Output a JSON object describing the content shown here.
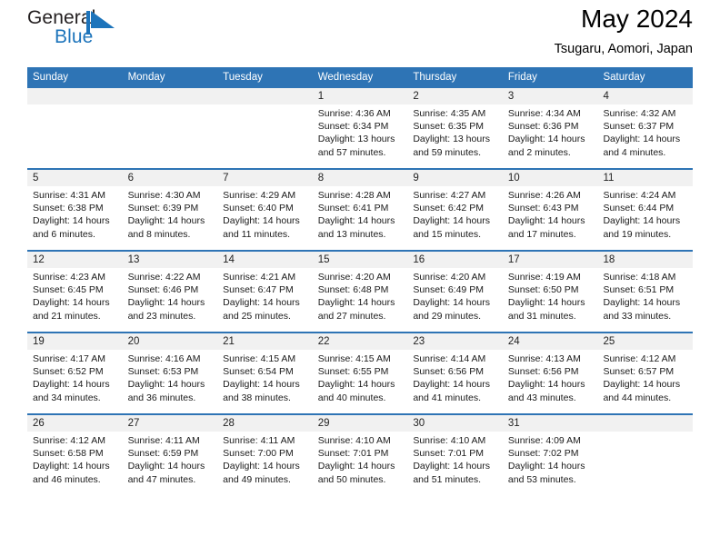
{
  "logo": {
    "word_one": "General",
    "word_two": "Blue",
    "mark_name": "blue-triangle-flag-icon",
    "color_dark": "#231f20",
    "color_blue": "#1d74bb"
  },
  "header": {
    "title": "May 2024",
    "subtitle": "Tsugaru, Aomori, Japan"
  },
  "theme": {
    "header_blue": "#2e74b5",
    "day_strip_gray": "#f1f1f1",
    "text": "#1a1a1a"
  },
  "weekdays": [
    "Sunday",
    "Monday",
    "Tuesday",
    "Wednesday",
    "Thursday",
    "Friday",
    "Saturday"
  ],
  "weeks": [
    [
      {
        "day": "",
        "sunrise": "",
        "sunset": "",
        "daylight_line1": "",
        "daylight_line2": ""
      },
      {
        "day": "",
        "sunrise": "",
        "sunset": "",
        "daylight_line1": "",
        "daylight_line2": ""
      },
      {
        "day": "",
        "sunrise": "",
        "sunset": "",
        "daylight_line1": "",
        "daylight_line2": ""
      },
      {
        "day": "1",
        "sunrise": "Sunrise: 4:36 AM",
        "sunset": "Sunset: 6:34 PM",
        "daylight_line1": "Daylight: 13 hours",
        "daylight_line2": "and 57 minutes."
      },
      {
        "day": "2",
        "sunrise": "Sunrise: 4:35 AM",
        "sunset": "Sunset: 6:35 PM",
        "daylight_line1": "Daylight: 13 hours",
        "daylight_line2": "and 59 minutes."
      },
      {
        "day": "3",
        "sunrise": "Sunrise: 4:34 AM",
        "sunset": "Sunset: 6:36 PM",
        "daylight_line1": "Daylight: 14 hours",
        "daylight_line2": "and 2 minutes."
      },
      {
        "day": "4",
        "sunrise": "Sunrise: 4:32 AM",
        "sunset": "Sunset: 6:37 PM",
        "daylight_line1": "Daylight: 14 hours",
        "daylight_line2": "and 4 minutes."
      }
    ],
    [
      {
        "day": "5",
        "sunrise": "Sunrise: 4:31 AM",
        "sunset": "Sunset: 6:38 PM",
        "daylight_line1": "Daylight: 14 hours",
        "daylight_line2": "and 6 minutes."
      },
      {
        "day": "6",
        "sunrise": "Sunrise: 4:30 AM",
        "sunset": "Sunset: 6:39 PM",
        "daylight_line1": "Daylight: 14 hours",
        "daylight_line2": "and 8 minutes."
      },
      {
        "day": "7",
        "sunrise": "Sunrise: 4:29 AM",
        "sunset": "Sunset: 6:40 PM",
        "daylight_line1": "Daylight: 14 hours",
        "daylight_line2": "and 11 minutes."
      },
      {
        "day": "8",
        "sunrise": "Sunrise: 4:28 AM",
        "sunset": "Sunset: 6:41 PM",
        "daylight_line1": "Daylight: 14 hours",
        "daylight_line2": "and 13 minutes."
      },
      {
        "day": "9",
        "sunrise": "Sunrise: 4:27 AM",
        "sunset": "Sunset: 6:42 PM",
        "daylight_line1": "Daylight: 14 hours",
        "daylight_line2": "and 15 minutes."
      },
      {
        "day": "10",
        "sunrise": "Sunrise: 4:26 AM",
        "sunset": "Sunset: 6:43 PM",
        "daylight_line1": "Daylight: 14 hours",
        "daylight_line2": "and 17 minutes."
      },
      {
        "day": "11",
        "sunrise": "Sunrise: 4:24 AM",
        "sunset": "Sunset: 6:44 PM",
        "daylight_line1": "Daylight: 14 hours",
        "daylight_line2": "and 19 minutes."
      }
    ],
    [
      {
        "day": "12",
        "sunrise": "Sunrise: 4:23 AM",
        "sunset": "Sunset: 6:45 PM",
        "daylight_line1": "Daylight: 14 hours",
        "daylight_line2": "and 21 minutes."
      },
      {
        "day": "13",
        "sunrise": "Sunrise: 4:22 AM",
        "sunset": "Sunset: 6:46 PM",
        "daylight_line1": "Daylight: 14 hours",
        "daylight_line2": "and 23 minutes."
      },
      {
        "day": "14",
        "sunrise": "Sunrise: 4:21 AM",
        "sunset": "Sunset: 6:47 PM",
        "daylight_line1": "Daylight: 14 hours",
        "daylight_line2": "and 25 minutes."
      },
      {
        "day": "15",
        "sunrise": "Sunrise: 4:20 AM",
        "sunset": "Sunset: 6:48 PM",
        "daylight_line1": "Daylight: 14 hours",
        "daylight_line2": "and 27 minutes."
      },
      {
        "day": "16",
        "sunrise": "Sunrise: 4:20 AM",
        "sunset": "Sunset: 6:49 PM",
        "daylight_line1": "Daylight: 14 hours",
        "daylight_line2": "and 29 minutes."
      },
      {
        "day": "17",
        "sunrise": "Sunrise: 4:19 AM",
        "sunset": "Sunset: 6:50 PM",
        "daylight_line1": "Daylight: 14 hours",
        "daylight_line2": "and 31 minutes."
      },
      {
        "day": "18",
        "sunrise": "Sunrise: 4:18 AM",
        "sunset": "Sunset: 6:51 PM",
        "daylight_line1": "Daylight: 14 hours",
        "daylight_line2": "and 33 minutes."
      }
    ],
    [
      {
        "day": "19",
        "sunrise": "Sunrise: 4:17 AM",
        "sunset": "Sunset: 6:52 PM",
        "daylight_line1": "Daylight: 14 hours",
        "daylight_line2": "and 34 minutes."
      },
      {
        "day": "20",
        "sunrise": "Sunrise: 4:16 AM",
        "sunset": "Sunset: 6:53 PM",
        "daylight_line1": "Daylight: 14 hours",
        "daylight_line2": "and 36 minutes."
      },
      {
        "day": "21",
        "sunrise": "Sunrise: 4:15 AM",
        "sunset": "Sunset: 6:54 PM",
        "daylight_line1": "Daylight: 14 hours",
        "daylight_line2": "and 38 minutes."
      },
      {
        "day": "22",
        "sunrise": "Sunrise: 4:15 AM",
        "sunset": "Sunset: 6:55 PM",
        "daylight_line1": "Daylight: 14 hours",
        "daylight_line2": "and 40 minutes."
      },
      {
        "day": "23",
        "sunrise": "Sunrise: 4:14 AM",
        "sunset": "Sunset: 6:56 PM",
        "daylight_line1": "Daylight: 14 hours",
        "daylight_line2": "and 41 minutes."
      },
      {
        "day": "24",
        "sunrise": "Sunrise: 4:13 AM",
        "sunset": "Sunset: 6:56 PM",
        "daylight_line1": "Daylight: 14 hours",
        "daylight_line2": "and 43 minutes."
      },
      {
        "day": "25",
        "sunrise": "Sunrise: 4:12 AM",
        "sunset": "Sunset: 6:57 PM",
        "daylight_line1": "Daylight: 14 hours",
        "daylight_line2": "and 44 minutes."
      }
    ],
    [
      {
        "day": "26",
        "sunrise": "Sunrise: 4:12 AM",
        "sunset": "Sunset: 6:58 PM",
        "daylight_line1": "Daylight: 14 hours",
        "daylight_line2": "and 46 minutes."
      },
      {
        "day": "27",
        "sunrise": "Sunrise: 4:11 AM",
        "sunset": "Sunset: 6:59 PM",
        "daylight_line1": "Daylight: 14 hours",
        "daylight_line2": "and 47 minutes."
      },
      {
        "day": "28",
        "sunrise": "Sunrise: 4:11 AM",
        "sunset": "Sunset: 7:00 PM",
        "daylight_line1": "Daylight: 14 hours",
        "daylight_line2": "and 49 minutes."
      },
      {
        "day": "29",
        "sunrise": "Sunrise: 4:10 AM",
        "sunset": "Sunset: 7:01 PM",
        "daylight_line1": "Daylight: 14 hours",
        "daylight_line2": "and 50 minutes."
      },
      {
        "day": "30",
        "sunrise": "Sunrise: 4:10 AM",
        "sunset": "Sunset: 7:01 PM",
        "daylight_line1": "Daylight: 14 hours",
        "daylight_line2": "and 51 minutes."
      },
      {
        "day": "31",
        "sunrise": "Sunrise: 4:09 AM",
        "sunset": "Sunset: 7:02 PM",
        "daylight_line1": "Daylight: 14 hours",
        "daylight_line2": "and 53 minutes."
      },
      {
        "day": "",
        "sunrise": "",
        "sunset": "",
        "daylight_line1": "",
        "daylight_line2": ""
      }
    ]
  ]
}
